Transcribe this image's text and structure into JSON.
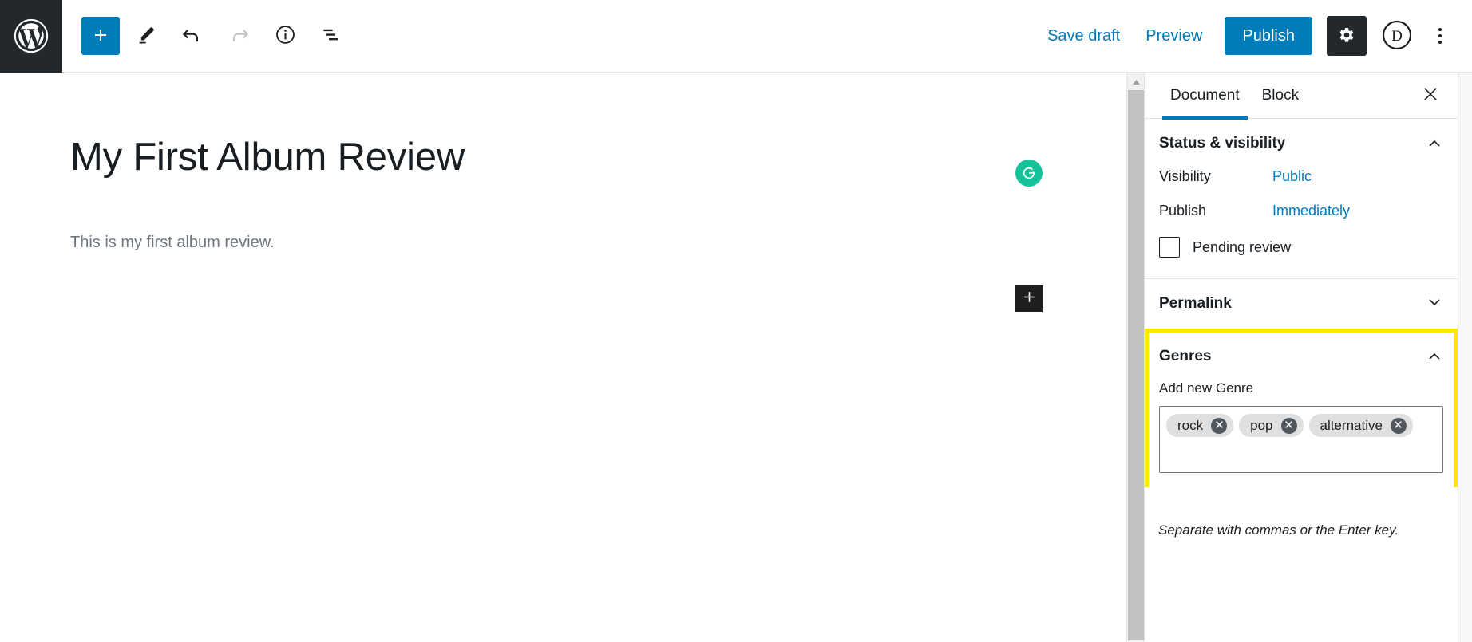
{
  "toolbar": {
    "logo_icon": "wordpress-logo-icon",
    "add_block_label": "+",
    "add_block_icon": "plus-icon",
    "edit_icon": "pencil-icon",
    "undo_icon": "undo-arrow-icon",
    "redo_icon": "redo-arrow-icon",
    "info_icon": "info-circle-icon",
    "list_view_icon": "list-view-icon",
    "save_draft_label": "Save draft",
    "preview_label": "Preview",
    "publish_label": "Publish",
    "settings_icon": "gear-icon",
    "avatar_label": "D",
    "more_icon": "kebab-menu-icon"
  },
  "editor": {
    "title": "My First Album Review",
    "paragraph": "This is my first album review.",
    "grammarly_icon": "grammarly-g-icon",
    "appender_icon": "plus-icon"
  },
  "sidebar": {
    "tabs": [
      {
        "label": "Document",
        "active": true
      },
      {
        "label": "Block",
        "active": false
      }
    ],
    "close_icon": "close-icon",
    "panels": {
      "status": {
        "title": "Status & visibility",
        "chevron": "chevron-up-icon",
        "visibility_label": "Visibility",
        "visibility_value": "Public",
        "publish_label": "Publish",
        "publish_value": "Immediately",
        "pending_review_label": "Pending review",
        "pending_review_checked": false
      },
      "permalink": {
        "title": "Permalink",
        "chevron": "chevron-down-icon"
      },
      "genres": {
        "title": "Genres",
        "chevron": "chevron-up-icon",
        "field_label": "Add new Genre",
        "tokens": [
          "rock",
          "pop",
          "alternative"
        ],
        "remove_icon": "remove-x-icon",
        "help_text": "Separate with commas or the Enter key.",
        "highlight_color": "#ffe800"
      }
    }
  },
  "colors": {
    "accent": "#007cba",
    "dark": "#23282d",
    "grammarly_green": "#15c39a",
    "highlight": "#ffe800",
    "token_bg": "#e0e0e0"
  }
}
